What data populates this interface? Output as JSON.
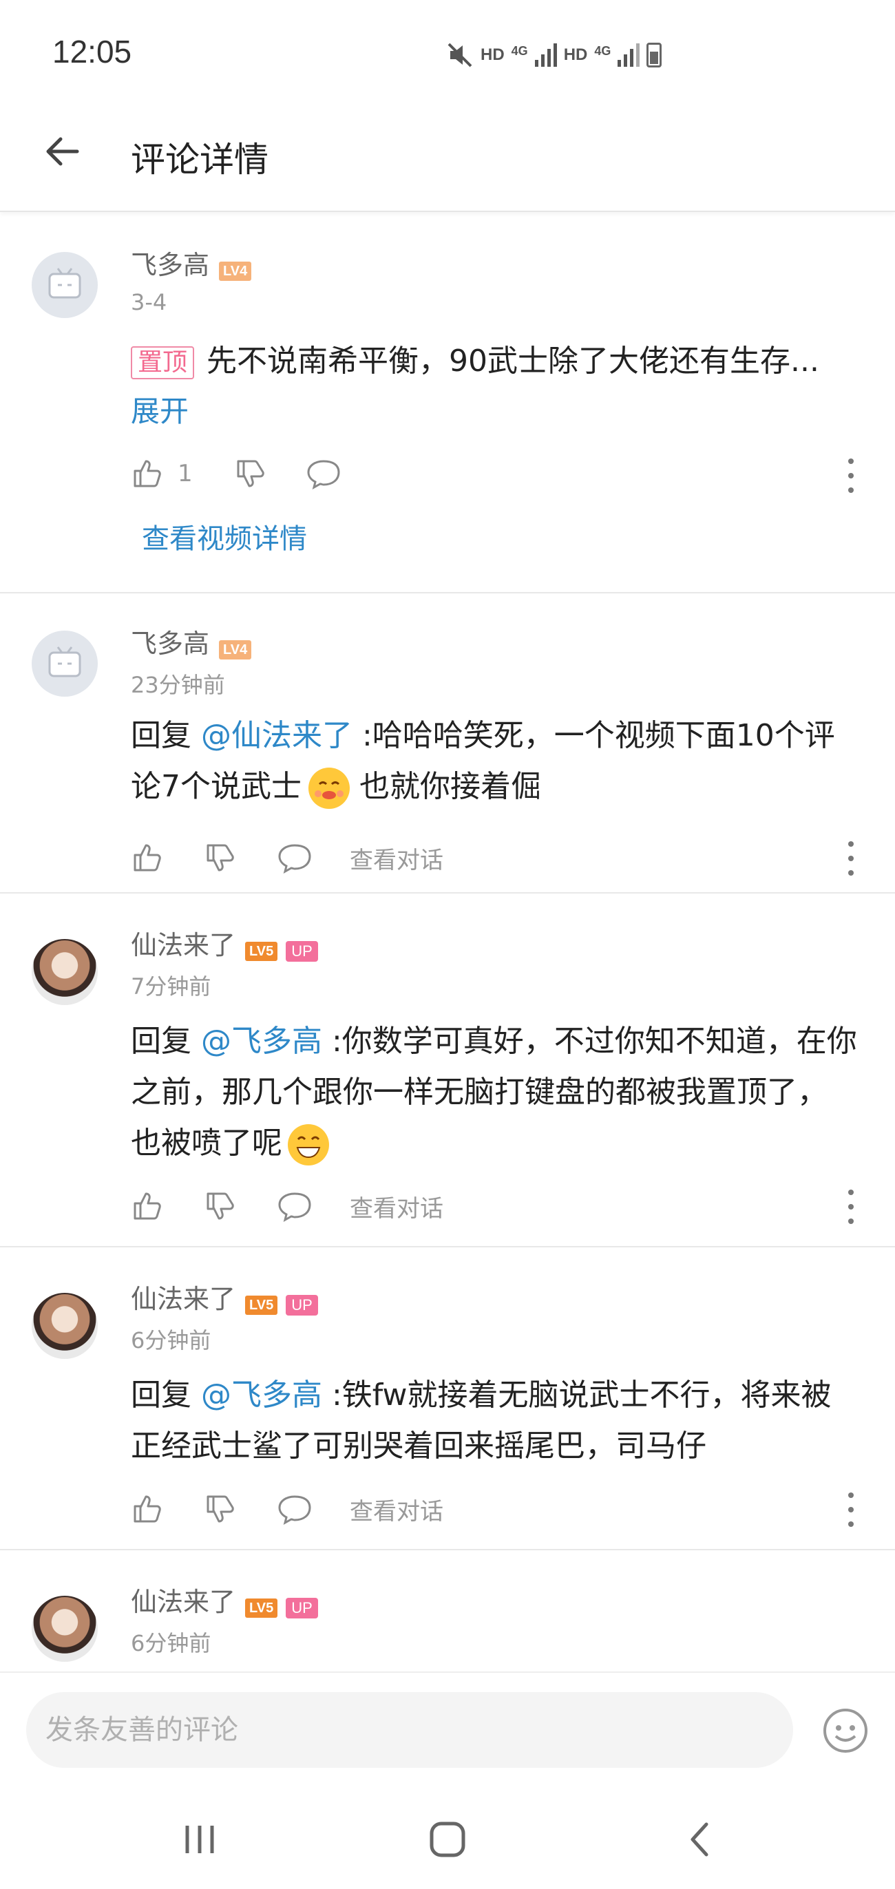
{
  "status": {
    "time": "12:05",
    "net1": "HD",
    "g1": "4G",
    "net2": "HD",
    "g2": "4G"
  },
  "header": {
    "title": "评论详情"
  },
  "comments": [
    {
      "user": "飞多高",
      "level": "LV4",
      "time": "3-4",
      "pin": "置顶",
      "text": "先不说南希平衡，90武士除了大佬还有生存...",
      "expand": "展开",
      "likes": "1",
      "link": "查看视频详情"
    },
    {
      "user": "飞多高",
      "level": "LV4",
      "time": "23分钟前",
      "reply_prefix": "回复 ",
      "mention": "@仙法来了",
      "text1": " :哈哈哈笑死，一个视频下面10个评",
      "text2": "论7个说武士",
      "text3": " 也就你接着倔",
      "link": "查看对话"
    },
    {
      "user": "仙法来了",
      "level": "LV5",
      "badge": "UP",
      "time": "7分钟前",
      "reply_prefix": "回复 ",
      "mention": "@飞多高",
      "text1": " :你数学可真好，不过你知不知道，在你",
      "text2": "之前，那几个跟你一样无脑打键盘的都被我置顶了，",
      "text3": "也被喷了呢",
      "link": "查看对话"
    },
    {
      "user": "仙法来了",
      "level": "LV5",
      "badge": "UP",
      "time": "6分钟前",
      "reply_prefix": "回复 ",
      "mention": "@飞多高",
      "text1": " :铁fw就接着无脑说武士不行，将来被",
      "text2": "正经武士鲨了可别哭着回来摇尾巴，司马仔",
      "link": "查看对话"
    },
    {
      "user": "仙法来了",
      "level": "LV5",
      "badge": "UP",
      "time": "6分钟前"
    }
  ],
  "input": {
    "placeholder": "发条友善的评论"
  },
  "icons": {
    "back": "back-arrow-icon",
    "like": "thumbs-up-icon",
    "dislike": "thumbs-down-icon",
    "reply": "comment-bubble-icon",
    "more": "more-vertical-icon",
    "emoji": "emoji-icon"
  },
  "colors": {
    "link": "#2e88c8",
    "pin": "#f3698f",
    "up_badge": "#f36f9b",
    "lv4": "#f6b27a",
    "lv5": "#f08a2e"
  }
}
